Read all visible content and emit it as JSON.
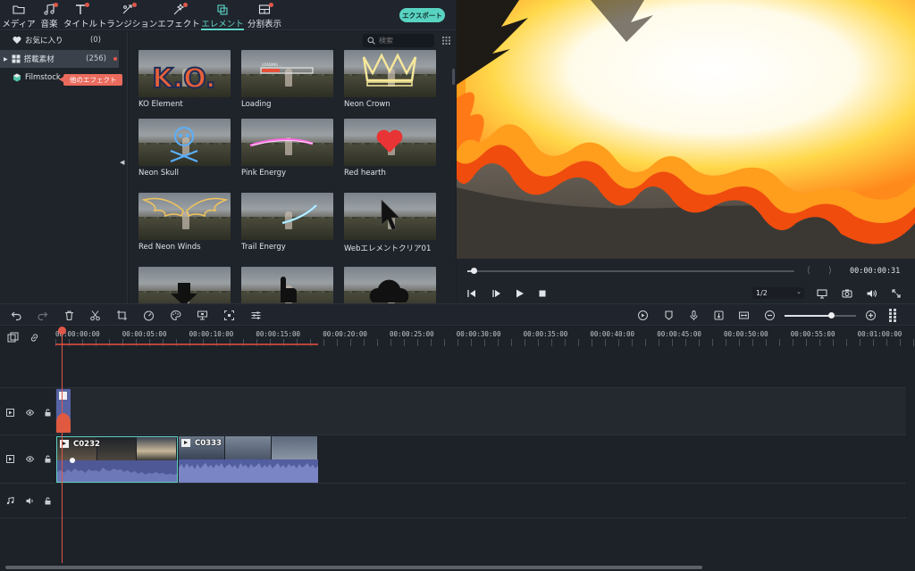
{
  "tabs": [
    {
      "label": "メディア",
      "icon": "folder-icon",
      "dot": false,
      "active": false
    },
    {
      "label": "音楽",
      "icon": "music-note-icon",
      "dot": true,
      "active": false
    },
    {
      "label": "タイトル",
      "icon": "title-text-icon",
      "dot": true,
      "active": false
    },
    {
      "label": "トランジション",
      "icon": "transition-icon",
      "dot": true,
      "active": false
    },
    {
      "label": "エフェクト",
      "icon": "effects-icon",
      "dot": true,
      "active": false
    },
    {
      "label": "エレメント",
      "icon": "elements-icon",
      "dot": false,
      "active": true
    },
    {
      "label": "分割表示",
      "icon": "split-screen-icon",
      "dot": true,
      "active": false
    }
  ],
  "export_label": "エクスポート",
  "sidebar": {
    "favorites": {
      "label": "お気に入り",
      "count": "(0)"
    },
    "builtin": {
      "label": "搭載素材",
      "count": "(256)"
    },
    "filmstock": {
      "label": "Filmstock"
    },
    "tooltip": "他のエフェクト"
  },
  "search": {
    "placeholder": "検索"
  },
  "elements": [
    {
      "name": "KO Element",
      "overlay": "ko"
    },
    {
      "name": "Loading",
      "overlay": "loading"
    },
    {
      "name": "Neon Crown",
      "overlay": "crown"
    },
    {
      "name": "Neon Skull",
      "overlay": "skull"
    },
    {
      "name": "Pink Energy",
      "overlay": "pink"
    },
    {
      "name": "Red hearth",
      "overlay": "heart"
    },
    {
      "name": "Red Neon Winds",
      "overlay": "wings"
    },
    {
      "name": "Trail Energy",
      "overlay": "trail"
    },
    {
      "name": "Webエレメントクリア01",
      "overlay": "cursor"
    },
    {
      "name": "",
      "overlay": "arrow"
    },
    {
      "name": "",
      "overlay": "hand"
    },
    {
      "name": "",
      "overlay": "cloud"
    }
  ],
  "preview": {
    "timecode": "00:00:00:31",
    "quality": "1/2",
    "progress": 0.02
  },
  "timeline": {
    "ruler": [
      "00:00:00:00",
      "00:00:05:00",
      "00:00:10:00",
      "00:00:15:00",
      "00:00:20:00",
      "00:00:25:00",
      "00:00:30:00",
      "00:00:35:00",
      "00:00:40:00",
      "00:00:45:00",
      "00:00:50:00",
      "00:00:55:00",
      "00:01:00:00"
    ],
    "clips": [
      {
        "name": "C0232"
      },
      {
        "name": "C0333"
      }
    ],
    "zoom": 0.65
  },
  "colors": {
    "accent": "#5fd6c9",
    "badge": "#e0574a",
    "clip": "#525ea0"
  }
}
